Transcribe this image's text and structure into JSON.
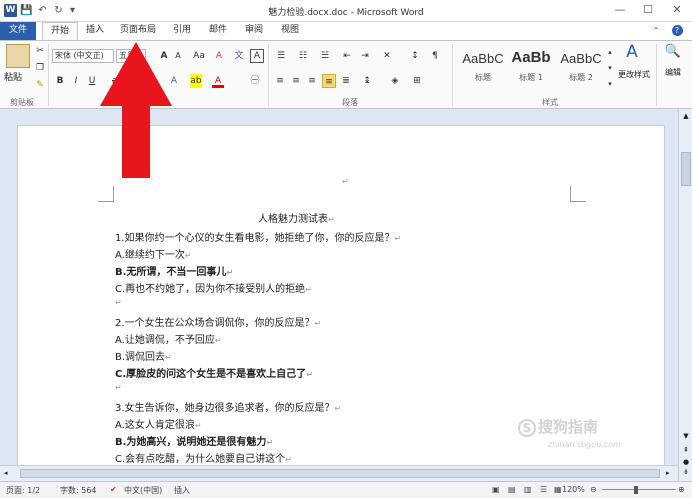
{
  "titlebar": {
    "title": "魅力检验.docx.doc - Microsoft Word",
    "word_icon": "W",
    "qa_save": "💾",
    "qa_undo": "↶",
    "qa_redo": "↻",
    "qa_more": "▾",
    "win_min": "—",
    "win_max": "☐",
    "win_close": "✕"
  },
  "tabs": [
    "文件",
    "开始",
    "插入",
    "页面布局",
    "引用",
    "邮件",
    "审阅",
    "视图"
  ],
  "active_tab": "开始",
  "ribbon": {
    "paste_label": "粘贴",
    "clipboard_group": "剪贴板",
    "font_name": "宋体 (中文正)",
    "font_size": "五号",
    "paragraph_group": "段落",
    "styles_group": "样式",
    "styles": [
      {
        "sample": "AaBbC",
        "name": "标题",
        "bold": false
      },
      {
        "sample": "AaBb",
        "name": "标题 1",
        "bold": true
      },
      {
        "sample": "AaBbC",
        "name": "标题 2",
        "bold": false
      }
    ],
    "change_styles": "更改样式",
    "edit": "编辑",
    "font_buttons": [
      "B",
      "I",
      "U",
      "A",
      "A"
    ],
    "grow_font": "A",
    "shrink_font": "A",
    "aa": "Aa",
    "clear_format": "A"
  },
  "document": {
    "title": "人格魅力测试表",
    "lines": [
      {
        "text": "1.如果你约一个心仪的女生看电影，她拒绝了你，你的反应是？",
        "bold": false
      },
      {
        "text": "A.继续约下一次",
        "bold": false
      },
      {
        "text": "B.无所谓，不当一回事儿",
        "bold": true
      },
      {
        "text": "C.再也不约她了，因为你不接受别人的拒绝",
        "bold": false
      },
      {
        "text": "",
        "bold": false
      },
      {
        "text": "2.一个女生在公众场合调侃你，你的反应是？",
        "bold": false
      },
      {
        "text": "A.让她调侃，不予回应",
        "bold": false
      },
      {
        "text": "B.调侃回去",
        "bold": false
      },
      {
        "text": "C.厚脸皮的问这个女生是不是喜欢上自己了",
        "bold": true
      },
      {
        "text": "",
        "bold": false
      },
      {
        "text": "3.女生告诉你，她身边很多追求者，你的反应是？",
        "bold": false
      },
      {
        "text": "A.这女人肯定很浪",
        "bold": false
      },
      {
        "text": "B.为她高兴，说明她还是很有魅力",
        "bold": true
      },
      {
        "text": "C.会有点吃醋，为什么她要自己讲这个",
        "bold": false
      }
    ],
    "paragraph_mark": "↵"
  },
  "status": {
    "page": "页面: 1/2",
    "words": "字数: 564",
    "lang": "中文(中国)",
    "mode": "插入",
    "zoom": "120%"
  },
  "watermark": {
    "text": "搜狗指南",
    "url": "zhinan.sogou.com"
  },
  "colors": {
    "file_tab": "#2b5fad",
    "arrow": "#e8151c"
  }
}
